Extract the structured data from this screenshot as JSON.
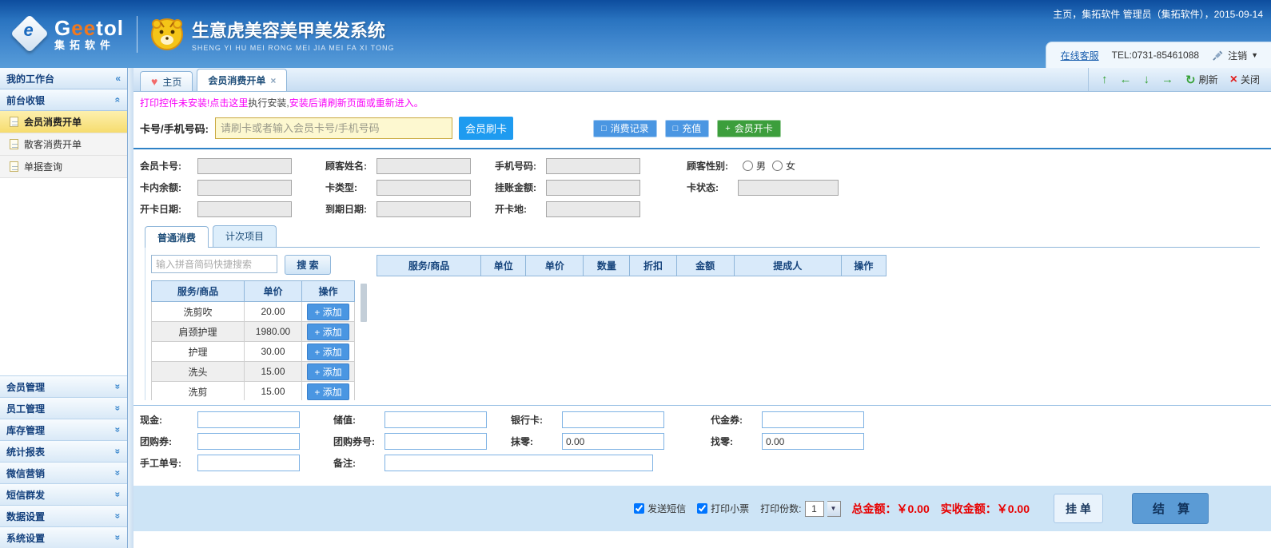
{
  "header": {
    "logo_g": "G",
    "logo_ee": "ee",
    "logo_tol": "tol",
    "logo_sub": "集拓软件",
    "app_title": "生意虎美容美甲美发系统",
    "app_subtitle": "SHENG YI HU MEI RONG MEI JIA MEI FA XI TONG",
    "user_info": "主页，集拓软件 管理员（集拓软件），2015-09-14",
    "online_service": "在线客服",
    "tel": "TEL:0731-85461088",
    "logout": "注销"
  },
  "sidebar": {
    "workbench_title": "我的工作台",
    "group_front": "前台收银",
    "front_items": [
      {
        "label": "会员消费开单"
      },
      {
        "label": "散客消费开单"
      },
      {
        "label": "单据查询"
      }
    ],
    "groups": [
      "会员管理",
      "员工管理",
      "库存管理",
      "统计报表",
      "微信营销",
      "短信群发",
      "数据设置",
      "系统设置"
    ]
  },
  "tabs": {
    "home": "主页",
    "current": "会员消费开单"
  },
  "toolbar": {
    "refresh": "刷新",
    "close": "关闭"
  },
  "notice": {
    "part1": "打印控件未安装!点击这里",
    "part2": "执行安装,",
    "part3": "安装后请刷新页面或重新进入。"
  },
  "card_row": {
    "label": "卡号/手机号码:",
    "placeholder": "请刷卡或者输入会员卡号/手机号码",
    "swipe_btn": "会员刷卡",
    "record_btn": "消费记录",
    "recharge_btn": "充值",
    "open_card_btn": "会员开卡"
  },
  "member_fields": {
    "card_no": "会员卡号:",
    "name": "顾客姓名:",
    "phone": "手机号码:",
    "gender": "顾客性别:",
    "male": "男",
    "female": "女",
    "balance": "卡内余额:",
    "card_type": "卡类型:",
    "credit": "挂账金额:",
    "card_status": "卡状态:",
    "open_date": "开卡日期:",
    "expire_date": "到期日期:",
    "open_place": "开卡地:"
  },
  "consume": {
    "tab_normal": "普通消费",
    "tab_times": "计次项目",
    "search_placeholder": "输入拼音简码快捷搜索",
    "search_btn": "搜 索",
    "item_table": {
      "headers": [
        "服务/商品",
        "单价",
        "操作"
      ],
      "add_btn": "+ 添加",
      "rows": [
        {
          "name": "洗剪吹",
          "price": "20.00"
        },
        {
          "name": "肩颈护理",
          "price": "1980.00"
        },
        {
          "name": "护理",
          "price": "30.00"
        },
        {
          "name": "洗头",
          "price": "15.00"
        },
        {
          "name": "洗剪",
          "price": "15.00"
        }
      ]
    },
    "cart_table": {
      "headers": [
        "服务/商品",
        "单位",
        "单价",
        "数量",
        "折扣",
        "金额",
        "提成人",
        "操作"
      ]
    }
  },
  "payment": {
    "cash": "现金:",
    "stored": "储值:",
    "bank_card": "银行卡:",
    "voucher": "代金券:",
    "groupon": "团购券:",
    "groupon_no": "团购券号:",
    "rounding": "抹零:",
    "rounding_value": "0.00",
    "change": "找零:",
    "change_value": "0.00",
    "manual_no": "手工单号:",
    "remark": "备注:"
  },
  "footer": {
    "send_sms": "发送短信",
    "print_ticket": "打印小票",
    "print_copies_label": "打印份数:",
    "print_copies_value": "1",
    "total_label": "总金额：￥0.00",
    "received_label": "实收金额：￥0.00",
    "hold_btn": "挂 单",
    "settle_btn": "结 算"
  },
  "icons": {
    "collapse": "«",
    "chev": "«",
    "chev_d": "»",
    "heart": "♥",
    "tab_close": "×",
    "up": "↑",
    "left": "←",
    "down": "↓",
    "right": "→",
    "refresh": "↻",
    "close": "×",
    "dropdown": "▼",
    "square": "□",
    "plus": "+"
  }
}
